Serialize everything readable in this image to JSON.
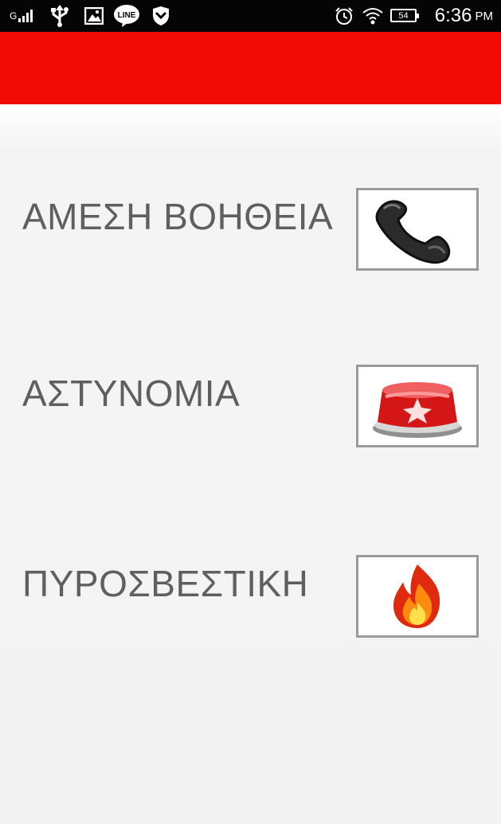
{
  "status_bar": {
    "network": "G",
    "time": "6:36",
    "ampm": "PM",
    "battery": "54",
    "icons": [
      "signal-icon",
      "usb-icon",
      "image-icon",
      "line-icon",
      "vpn-icon",
      "alarm-icon",
      "wifi-icon",
      "battery-icon"
    ]
  },
  "app_bar": {
    "color": "#f20a05"
  },
  "items": [
    {
      "label": "ΑΜΕΣΗ ΒΟΗΘΕΙΑ",
      "icon": "phone-handset-icon"
    },
    {
      "label": "ΑΣΤΥΝΟΜΙΑ",
      "icon": "police-siren-icon"
    },
    {
      "label": "ΠΥΡΟΣΒΕΣΤΙΚΗ",
      "icon": "fire-icon"
    }
  ]
}
